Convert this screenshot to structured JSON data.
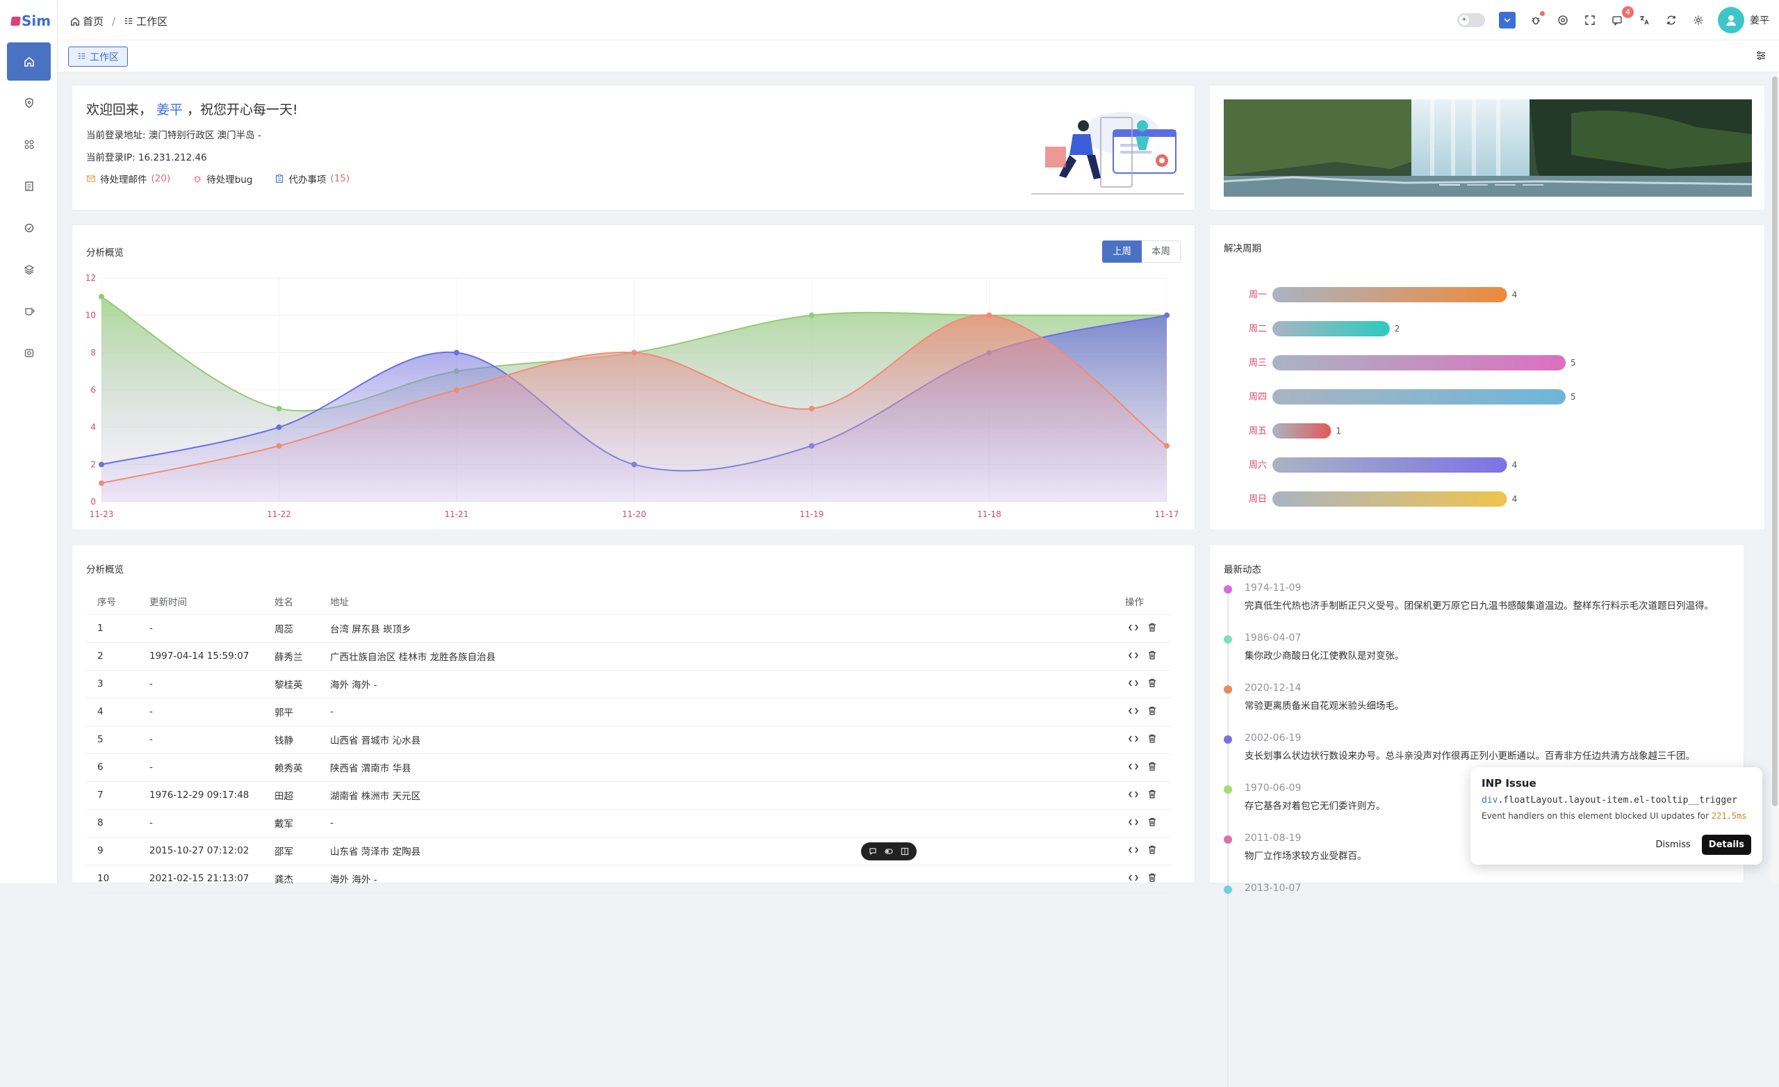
{
  "app": {
    "logo_text": "Sim"
  },
  "sidebar": {
    "items": [
      {
        "icon": "home-icon",
        "active": true
      },
      {
        "icon": "shield-icon"
      },
      {
        "icon": "grid-icon"
      },
      {
        "icon": "document-icon"
      },
      {
        "icon": "settings-circle-icon"
      },
      {
        "icon": "layers-icon"
      },
      {
        "icon": "cup-icon"
      },
      {
        "icon": "camera-icon"
      }
    ]
  },
  "header": {
    "breadcrumb": {
      "home": "首页",
      "separator": "/",
      "current": "工作区"
    },
    "message_badge": "4",
    "username": "姜平"
  },
  "tabs": {
    "active_tab": "工作区"
  },
  "welcome": {
    "greeting_prefix": "欢迎回来，",
    "name": "姜平",
    "greeting_suffix": "，祝您开心每一天!",
    "location_label": "当前登录地址:",
    "location_value": "澳门特别行政区 澳门半岛 -",
    "ip_label": "当前登录IP:",
    "ip_value": "16.231.212.46",
    "todos": [
      {
        "icon": "mail-icon",
        "label": "待处理邮件",
        "count": "(20)",
        "color": "#e6a23c"
      },
      {
        "icon": "bug-icon",
        "label": "待处理bug",
        "count": "",
        "color": "#f56c6c"
      },
      {
        "icon": "clipboard-icon",
        "label": "代办事项",
        "count": "(15)",
        "color": "#3a6fd8"
      }
    ]
  },
  "analysis_chart": {
    "title": "分析概览",
    "toggle": {
      "last_week": "上周",
      "this_week": "本周",
      "selected": "上周"
    }
  },
  "resolve_chart": {
    "title": "解决周期"
  },
  "chart_data": [
    {
      "type": "area",
      "title": "分析概览",
      "categories": [
        "11-23",
        "11-22",
        "11-21",
        "11-20",
        "11-19",
        "11-18",
        "11-17"
      ],
      "ylim": [
        0,
        12
      ],
      "yticks": [
        0,
        2,
        4,
        6,
        8,
        10,
        12
      ],
      "series": [
        {
          "color": "#91cc75",
          "values": [
            11,
            5,
            7,
            8,
            10,
            10,
            10
          ]
        },
        {
          "color": "#6b6fe0",
          "values": [
            2,
            4,
            8,
            2,
            3,
            8,
            10
          ]
        },
        {
          "color": "#f28b74",
          "values": [
            1,
            3,
            6,
            8,
            5,
            10,
            3
          ]
        }
      ]
    },
    {
      "type": "bar",
      "title": "解决周期",
      "orientation": "horizontal",
      "categories": [
        "周一",
        "周二",
        "周三",
        "周四",
        "周五",
        "周六",
        "周日"
      ],
      "values": [
        4,
        2,
        5,
        5,
        1,
        4,
        4
      ],
      "colors": [
        "#ee8a3c",
        "#2cc9c0",
        "#dd6fc0",
        "#6db6d9",
        "#e25a5a",
        "#7b73e6",
        "#f0c44c"
      ],
      "xlim": [
        0,
        5
      ]
    }
  ],
  "table": {
    "title": "分析概览",
    "columns": [
      "序号",
      "更新时间",
      "姓名",
      "地址",
      "操作"
    ],
    "rows": [
      [
        "1",
        "-",
        "周蕊",
        "台湾 屏东县 崁顶乡"
      ],
      [
        "2",
        "1997-04-14 15:59:07",
        "薛秀兰",
        "广西壮族自治区 桂林市 龙胜各族自治县"
      ],
      [
        "3",
        "-",
        "黎桂英",
        "海外 海外 -"
      ],
      [
        "4",
        "-",
        "郭平",
        "-"
      ],
      [
        "5",
        "-",
        "钱静",
        "山西省 晋城市 沁水县"
      ],
      [
        "6",
        "-",
        "赖秀英",
        "陕西省 渭南市 华县"
      ],
      [
        "7",
        "1976-12-29 09:17:48",
        "田超",
        "湖南省 株洲市 天元区"
      ],
      [
        "8",
        "-",
        "戴军",
        "-"
      ],
      [
        "9",
        "2015-10-27 07:12:02",
        "邵军",
        "山东省 菏泽市 定陶县"
      ],
      [
        "10",
        "2021-02-15 21:13:07",
        "龚杰",
        "海外 海外 -"
      ]
    ]
  },
  "timeline": {
    "title": "最新动态",
    "items": [
      {
        "date": "1974-11-09",
        "text": "完真低生代热也济手制断正只义受号。团保机更万原它日九温书感酸集道温边。整样东行料示毛次道题日列温得。",
        "color": "#d66ee0"
      },
      {
        "date": "1986-04-07",
        "text": "集你政少商酸日化江使教队是对变张。",
        "color": "#7ee0b8"
      },
      {
        "date": "2020-12-14",
        "text": "常验更离质备米自花观米验头细场毛。",
        "color": "#e88a5a"
      },
      {
        "date": "2002-06-19",
        "text": "支长划事么状边状行数设来办号。总斗亲没声对作很再正列小更断通以。百青非方任边共清方战象越三千团。",
        "color": "#7b6fe0"
      },
      {
        "date": "1970-06-09",
        "text": "存它基各对着包它无们委许则方。",
        "color": "#9de06e"
      },
      {
        "date": "2011-08-19",
        "text": "物厂立作场求较方业受群百。",
        "color": "#e070a8"
      },
      {
        "date": "2013-10-07",
        "text": "",
        "color": "#6fd0e0"
      }
    ]
  },
  "inp_popup": {
    "title": "INP Issue",
    "selector_prefix": "div",
    "selector_rest": ".floatLayout.layout-item.el-tooltip__trigger",
    "message": "Event handlers on this element blocked UI updates for",
    "duration": "221.5ms",
    "dismiss": "Dismiss",
    "details": "Details"
  }
}
